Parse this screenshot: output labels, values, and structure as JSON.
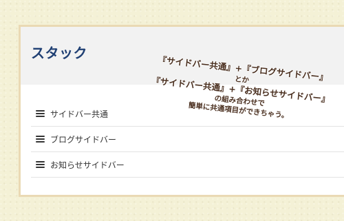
{
  "widget": {
    "title": "スタック",
    "menu": [
      {
        "label": "サイドバー共通",
        "icon": "hamburger-icon"
      },
      {
        "label": "ブログサイドバー",
        "icon": "hamburger-icon"
      },
      {
        "label": "お知らせサイドバー",
        "icon": "hamburger-icon"
      }
    ]
  },
  "annotation": {
    "line1": "『サイドバー共通』+『ブログサイドバー』",
    "line2": "とか",
    "line3": "『サイドバー共通』+『お知らせサイドバー』",
    "line4": "の組み合わせで",
    "line5": "簡単に共通項目ができちゃう。"
  },
  "colors": {
    "background": "#f4f1d6",
    "frame_border": "#ead9b4",
    "header_background": "#f2f2f2",
    "title_color": "#1f3f73",
    "annotation_color": "#4a2f1f"
  }
}
